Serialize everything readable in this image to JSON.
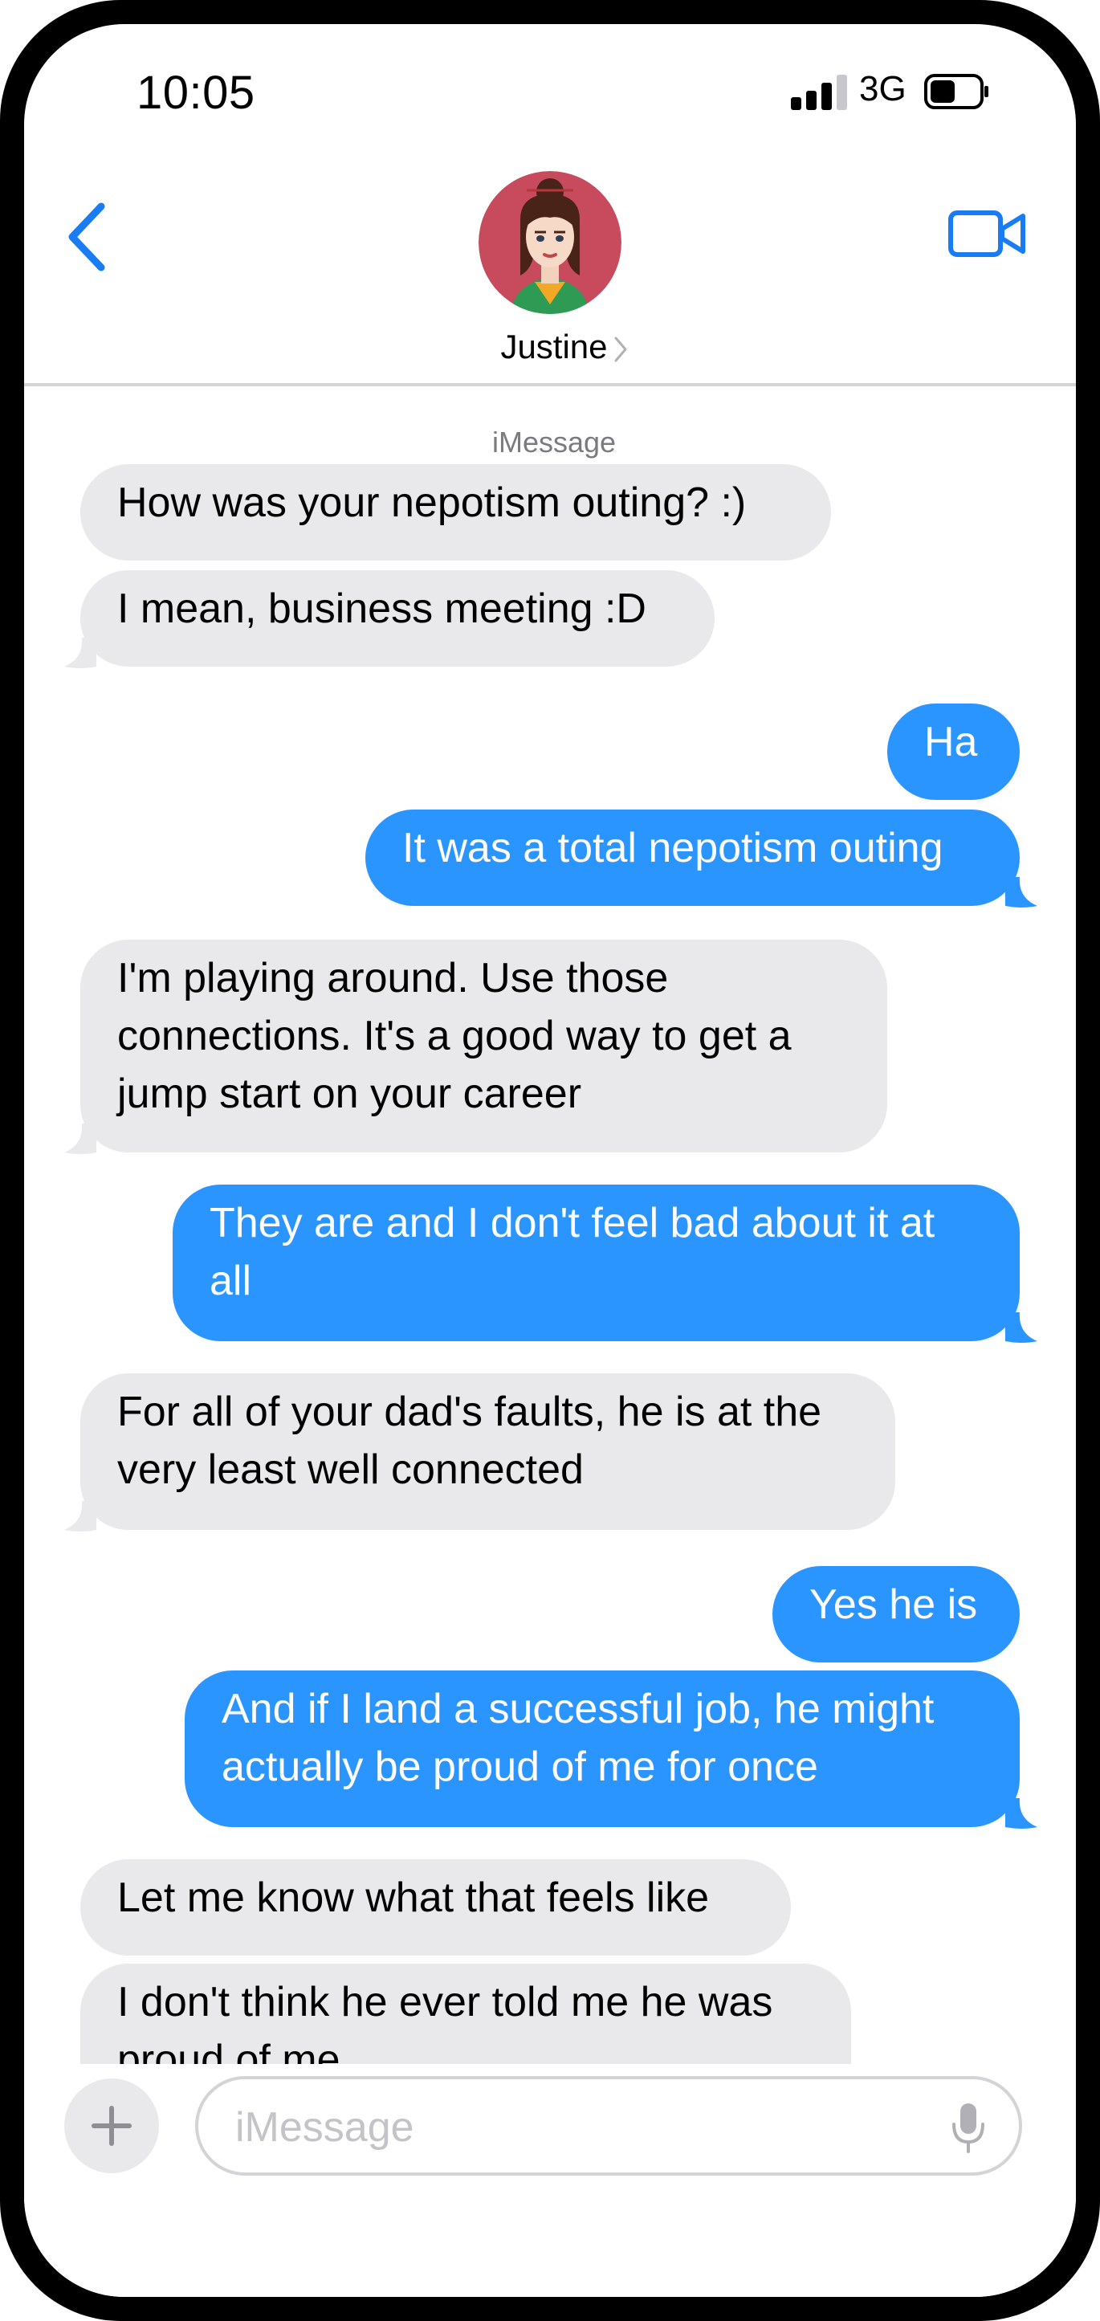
{
  "status_bar": {
    "time": "10:05",
    "network": "3G"
  },
  "header": {
    "contact_name": "Justine",
    "avatar_icon": "woman-avatar-icon",
    "back_icon": "chevron-left-icon",
    "video_icon": "video-camera-icon"
  },
  "conversation": {
    "service_label": "iMessage",
    "messages": [
      {
        "direction": "incoming",
        "text": "How was your nepotism outing? :)"
      },
      {
        "direction": "incoming",
        "text": "I mean, business meeting :D"
      },
      {
        "direction": "outgoing",
        "text": "Ha"
      },
      {
        "direction": "outgoing",
        "text": "It was a total nepotism outing"
      },
      {
        "direction": "incoming",
        "text": "I'm playing around.  Use those connections.  It's a good way to get a jump start on your career"
      },
      {
        "direction": "outgoing",
        "text": "They are and I don't feel bad about it at all"
      },
      {
        "direction": "incoming",
        "text": "For all of your dad's faults, he is at the very least well connected"
      },
      {
        "direction": "outgoing",
        "text": "Yes he is"
      },
      {
        "direction": "outgoing",
        "text": "And if I land a successful job, he might actually be proud of me for once"
      },
      {
        "direction": "incoming",
        "text": "Let me know what that feels like"
      },
      {
        "direction": "incoming",
        "text": "I don't think he ever told me he was proud of me"
      }
    ]
  },
  "composer": {
    "placeholder": "iMessage",
    "plus_icon": "plus-icon",
    "mic_icon": "microphone-icon"
  },
  "colors": {
    "outgoing_bubble": "#2b95ff",
    "incoming_bubble": "#e9e9eb",
    "accent": "#1a7cf2"
  }
}
